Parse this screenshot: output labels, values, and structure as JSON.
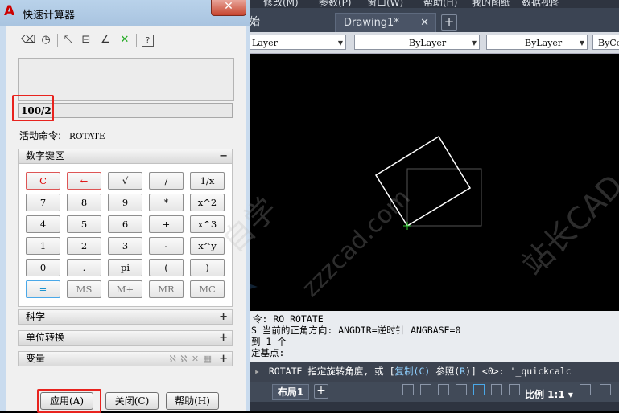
{
  "calculator": {
    "title": "快速计算器",
    "close_symbol": "✕",
    "toolbar_icons": [
      "clear-icon",
      "clear-history-icon",
      "get-coordinates-icon",
      "distance-icon",
      "angle-icon",
      "intersection-icon",
      "help-icon"
    ],
    "toolbar_glyphs": {
      "clear": "⌫",
      "history": "◷",
      "coord": "⤡",
      "distance": "⊟",
      "angle": "∠",
      "intersection": "✕",
      "help": "?"
    },
    "input_value": "100/2",
    "active_command_label": "活动命令:",
    "active_command_value": "ROTATE",
    "numpad_header": "数字键区",
    "numpad_sign": "−",
    "keys": [
      [
        "C",
        "←",
        "√",
        "/",
        "1/x"
      ],
      [
        "7",
        "8",
        "9",
        "*",
        "x^2"
      ],
      [
        "4",
        "5",
        "6",
        "+",
        "x^3"
      ],
      [
        "1",
        "2",
        "3",
        "-",
        "x^y"
      ],
      [
        "0",
        ".",
        "pi",
        "(",
        ")"
      ],
      [
        "=",
        "MS",
        "M+",
        "MR",
        "MC"
      ]
    ],
    "sections": [
      {
        "label": "科学",
        "sign": "+"
      },
      {
        "label": "单位转换",
        "sign": "+"
      },
      {
        "label": "变量",
        "sign": "+",
        "icons": "ℵ ℵ ✕ ▦"
      }
    ],
    "buttons": {
      "apply": "应用",
      "apply_key": "(A)",
      "close": "关闭",
      "close_key": "(C)",
      "help": "帮助",
      "help_key": "(H)"
    }
  },
  "cad": {
    "menu": [
      "修改(M)",
      "参数(P)",
      "窗口(W)",
      "帮助(H)",
      "我的图纸",
      "数据视图"
    ],
    "tabs": {
      "left_partial": "始",
      "active": "Drawing1*",
      "close_symbol": "✕",
      "add": "+"
    },
    "properties": {
      "layer": "Layer",
      "linetype": "ByLayer",
      "lineweight": "ByLayer",
      "color": "ByCo"
    },
    "command_history": [
      "令: RO ROTATE",
      "S 当前的正角方向:  ANGDIR=逆时针   ANGBASE=0",
      "到 1 个",
      "定基点:"
    ],
    "command_line": {
      "prefix": "▸",
      "text_before": "ROTATE 指定旋转角度, 或 [",
      "opt1": "复制(C)",
      "mid": " 参照(",
      "opt2_key": "R",
      "after": ")] <0>:  '_quickcalc"
    },
    "layout_tab": "布局1",
    "layout_add": "+",
    "scale_label": "比例 1:1",
    "scale_arrow": "▾"
  },
  "watermark": {
    "line1": "自学",
    "line2": "站长CAD",
    "line3": "zzzcad.com"
  }
}
